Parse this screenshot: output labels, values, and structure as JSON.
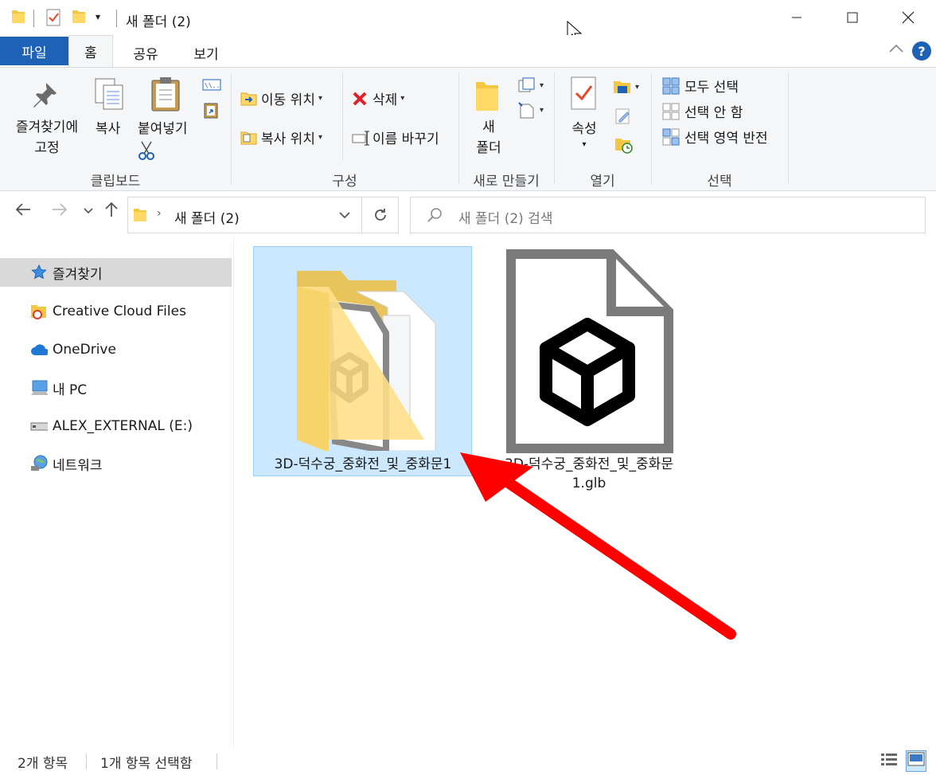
{
  "window": {
    "title": "새 폴더 (2)",
    "minimize_glyph": "—",
    "close_glyph": "✕"
  },
  "tabs": {
    "file": "파일",
    "home": "홈",
    "share": "공유",
    "view": "보기"
  },
  "ribbon": {
    "clipboard": {
      "pin_label_1": "즐겨찾기에",
      "pin_label_2": "고정",
      "copy": "복사",
      "paste": "붙여넣기",
      "group": "클립보드"
    },
    "organize": {
      "move_to": "이동 위치",
      "copy_to": "복사 위치",
      "delete": "삭제",
      "rename": "이름 바꾸기",
      "group": "구성"
    },
    "new": {
      "new_folder_1": "새",
      "new_folder_2": "폴더",
      "group": "새로 만들기"
    },
    "open": {
      "properties": "속성",
      "group": "열기"
    },
    "select": {
      "select_all": "모두 선택",
      "select_none": "선택 안 함",
      "invert": "선택 영역 반전",
      "group": "선택"
    }
  },
  "address": {
    "path": "새 폴더 (2)",
    "search_placeholder": "새 폴더 (2) 검색"
  },
  "navpane": [
    {
      "label": "즐겨찾기",
      "icon": "star-icon"
    },
    {
      "label": "Creative Cloud Files",
      "icon": "creative-cloud-folder-icon"
    },
    {
      "label": "OneDrive",
      "icon": "cloud-icon"
    },
    {
      "label": "내 PC",
      "icon": "computer-icon"
    },
    {
      "label": "ALEX_EXTERNAL (E:)",
      "icon": "drive-icon"
    },
    {
      "label": "네트워크",
      "icon": "network-icon"
    }
  ],
  "files": [
    {
      "name": "3D-덕수궁_중화전_및_중화문1",
      "icon": "folder-icon"
    },
    {
      "name_line1": "3D-덕수궁_중화전_및_중화문",
      "name_line2": "1.glb",
      "icon": "3d-file-icon"
    }
  ],
  "status": {
    "count": "2개 항목",
    "selected": "1개 항목 선택함"
  },
  "colors": {
    "accent": "#1e62b8",
    "selection": "#cce8ff",
    "arrow": "#ff0000"
  }
}
